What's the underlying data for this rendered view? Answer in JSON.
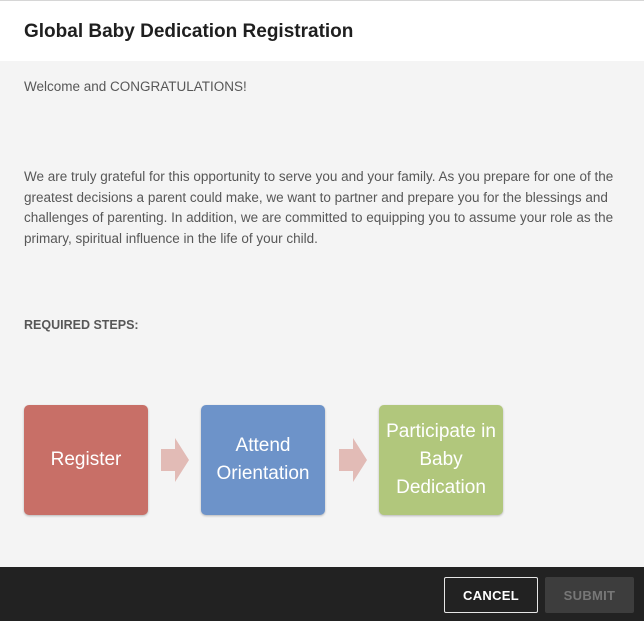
{
  "dialog": {
    "title": "Global Baby Dedication Registration"
  },
  "content": {
    "welcome": "Welcome and CONGRATULATIONS!",
    "intro": "We are truly grateful for this opportunity to serve you and your family. As you prepare for one of the greatest decisions a parent could make, we want to partner and prepare you for the blessings and challenges of parenting. In addition, we are committed to equipping you to assume your role as the primary, spiritual influence in the life of your child.",
    "steps_heading": "REQUIRED STEPS:",
    "steps": [
      {
        "label": "Register",
        "color": "#c86f67"
      },
      {
        "label": "Attend Orientation",
        "color": "#6d93c9"
      },
      {
        "label": "Participate in Baby Dedication",
        "color": "#b1c77c"
      }
    ],
    "arrow_icon": "arrow-right-icon",
    "arrow_color": "#e2bbb6"
  },
  "footer": {
    "cancel_label": "CANCEL",
    "submit_label": "SUBMIT"
  }
}
